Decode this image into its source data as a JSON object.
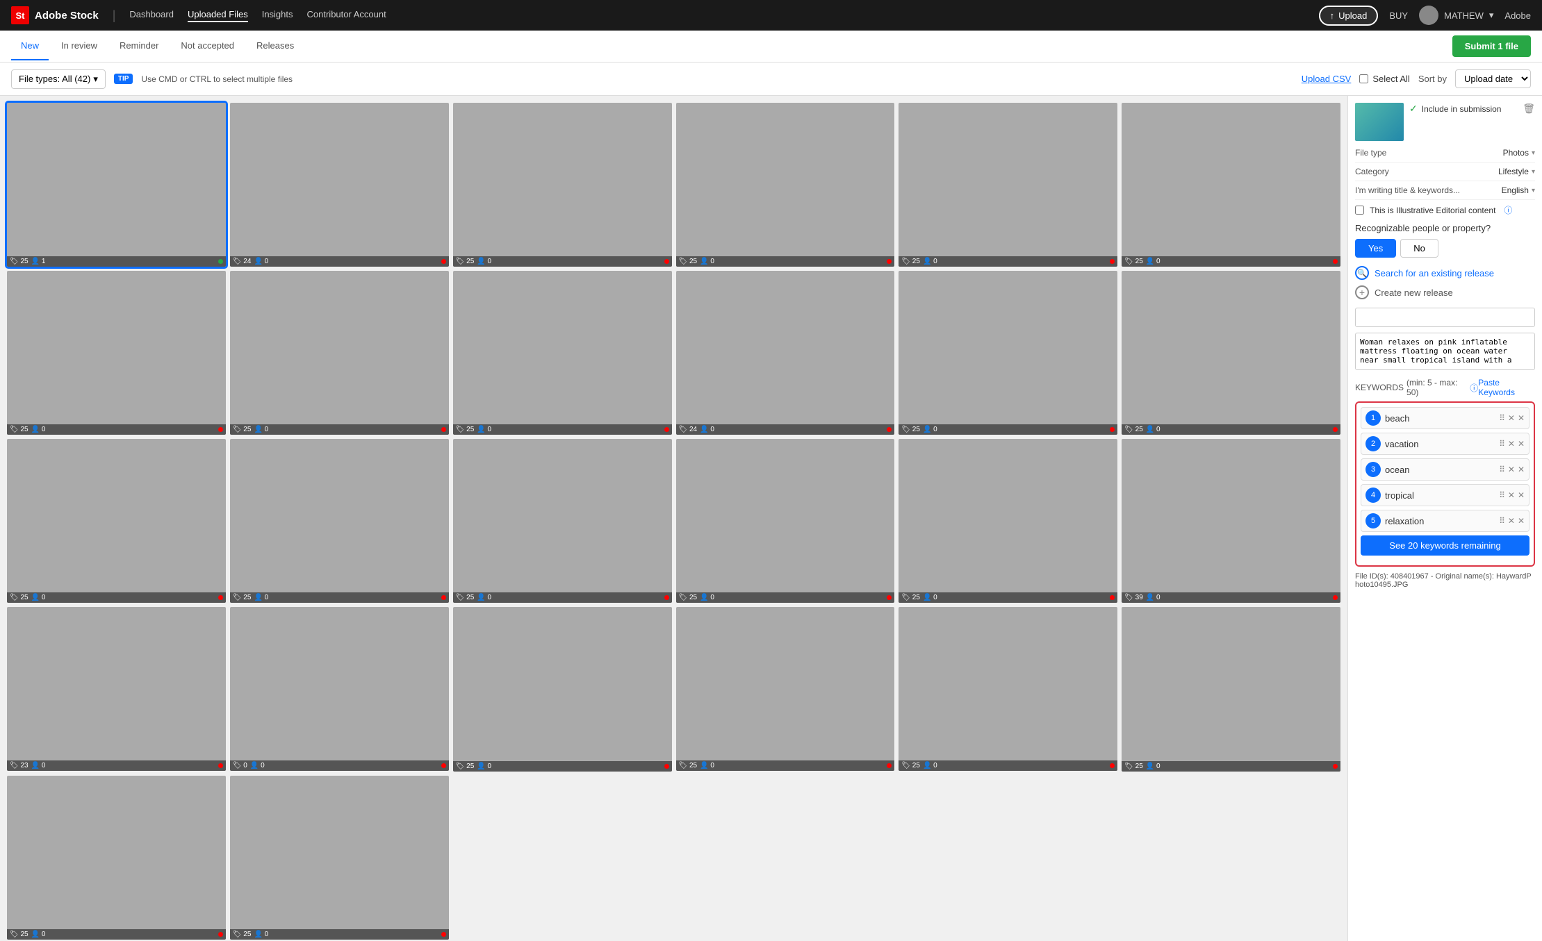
{
  "topNav": {
    "logoText": "St",
    "brandName": "Adobe Stock",
    "navLinks": [
      {
        "label": "Dashboard",
        "active": false
      },
      {
        "label": "Uploaded Files",
        "active": true
      },
      {
        "label": "Insights",
        "active": false
      },
      {
        "label": "Contributor Account",
        "active": false
      }
    ],
    "uploadBtn": "Upload",
    "buyBtn": "BUY",
    "userName": "MATHEW",
    "adobeLabel": "Adobe"
  },
  "tabs": [
    {
      "label": "New",
      "active": true
    },
    {
      "label": "In review",
      "active": false
    },
    {
      "label": "Reminder",
      "active": false
    },
    {
      "label": "Not accepted",
      "active": false
    },
    {
      "label": "Releases",
      "active": false
    }
  ],
  "submitBtn": "Submit 1 file",
  "toolbar": {
    "fileTypes": "File types: All (42)",
    "tipLabel": "TIP",
    "hintText": "Use CMD or CTRL to select multiple files",
    "uploadCsvBtn": "Upload CSV",
    "selectAllLabel": "Select All",
    "sortByLabel": "Sort by",
    "sortOption": "Upload date"
  },
  "photoGrid": {
    "photos": [
      {
        "id": 1,
        "colorClass": "cell-color-1",
        "keywords": 25,
        "people": 1,
        "status": "green",
        "selected": true
      },
      {
        "id": 2,
        "colorClass": "cell-color-2",
        "keywords": 24,
        "people": 0,
        "status": "red"
      },
      {
        "id": 3,
        "colorClass": "cell-color-3",
        "keywords": 25,
        "people": 0,
        "status": "red"
      },
      {
        "id": 4,
        "colorClass": "cell-color-4",
        "keywords": 25,
        "people": 0,
        "status": "red"
      },
      {
        "id": 5,
        "colorClass": "cell-color-5",
        "keywords": 25,
        "people": 0,
        "status": "red"
      },
      {
        "id": 6,
        "colorClass": "cell-color-6",
        "keywords": 25,
        "people": 0,
        "status": "red"
      },
      {
        "id": 7,
        "colorClass": "cell-color-7",
        "keywords": 25,
        "people": 0,
        "status": "red"
      },
      {
        "id": 8,
        "colorClass": "cell-color-8",
        "keywords": 25,
        "people": 0,
        "status": "red"
      },
      {
        "id": 9,
        "colorClass": "cell-color-9",
        "keywords": 25,
        "people": 0,
        "status": "red"
      },
      {
        "id": 10,
        "colorClass": "cell-color-10",
        "keywords": 24,
        "people": 0,
        "status": "red"
      },
      {
        "id": 11,
        "colorClass": "cell-color-11",
        "keywords": 25,
        "people": 0,
        "status": "red"
      },
      {
        "id": 12,
        "colorClass": "cell-color-12",
        "keywords": 25,
        "people": 0,
        "status": "red"
      },
      {
        "id": 13,
        "colorClass": "cell-color-13",
        "keywords": 25,
        "people": 0,
        "status": "red"
      },
      {
        "id": 14,
        "colorClass": "cell-color-14",
        "keywords": 25,
        "people": 0,
        "status": "red"
      },
      {
        "id": 15,
        "colorClass": "cell-color-15",
        "keywords": 25,
        "people": 0,
        "status": "red"
      },
      {
        "id": 16,
        "colorClass": "cell-color-16",
        "keywords": 25,
        "people": 0,
        "status": "red"
      },
      {
        "id": 17,
        "colorClass": "cell-color-17",
        "keywords": 25,
        "people": 0,
        "status": "red"
      },
      {
        "id": 18,
        "colorClass": "cell-color-18",
        "keywords": 39,
        "people": 0,
        "status": "red"
      },
      {
        "id": 19,
        "colorClass": "cell-color-19",
        "keywords": 23,
        "people": 0,
        "status": "red"
      },
      {
        "id": 20,
        "colorClass": "cell-color-20",
        "keywords": 0,
        "people": 0,
        "status": "red"
      },
      {
        "id": 21,
        "colorClass": "cell-color-21",
        "keywords": 25,
        "people": 0,
        "status": "red"
      },
      {
        "id": 22,
        "colorClass": "cell-color-22",
        "keywords": 25,
        "people": 0,
        "status": "red"
      },
      {
        "id": 23,
        "colorClass": "cell-color-23",
        "keywords": 25,
        "people": 0,
        "status": "red"
      },
      {
        "id": 24,
        "colorClass": "cell-color-24",
        "keywords": 25,
        "people": 0,
        "status": "red"
      },
      {
        "id": 25,
        "colorClass": "cell-color-25",
        "keywords": 25,
        "people": 0,
        "status": "red"
      },
      {
        "id": 26,
        "colorClass": "cell-color-26",
        "keywords": 25,
        "people": 0,
        "status": "red"
      }
    ]
  },
  "rightPanel": {
    "includeLabel": "Include in submission",
    "previewThumbColor": "#5ba89a",
    "fileTypeLabel": "File type",
    "fileTypeValue": "Photos",
    "categoryLabel": "Category",
    "categoryValue": "Lifestyle",
    "languageLabel": "I'm writing title & keywords...",
    "languageValue": "English",
    "illustrativeLabel": "This is Illustrative Editorial content",
    "peopleLabel": "Recognizable people or property?",
    "yesBtn": "Yes",
    "noBtn": "No",
    "searchReleaseLabel": "Search for an existing release",
    "createReleaseLabel": "Create new release",
    "titlePlaceholder": "",
    "titleText": "Woman relaxes on pink inflatable mattress floating on ocean water near small tropical island with a",
    "keywordsLabel": "KEYWORDS",
    "keywordsInfo": "(min: 5 - max: 50)",
    "pasteKeywordsBtn": "Paste Keywords",
    "keywords": [
      {
        "num": 1,
        "text": "beach"
      },
      {
        "num": 2,
        "text": "vacation"
      },
      {
        "num": 3,
        "text": "ocean"
      },
      {
        "num": 4,
        "text": "tropical"
      },
      {
        "num": 5,
        "text": "relaxation"
      }
    ],
    "seeMoreBtn": "See 20 keywords remaining",
    "fileIdLabel": "File ID(s): 408401967 - Original name(s): HaywardPhoto10495.JPG"
  }
}
